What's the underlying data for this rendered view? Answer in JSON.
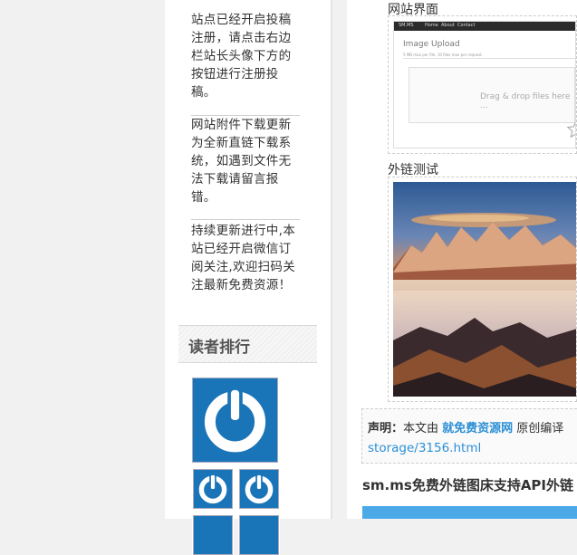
{
  "sidebar": {
    "notices": [
      "站点已经开启投稿注册，请点击右边栏站长头像下方的按钮进行注册投稿。",
      "网站附件下载更新为全新直链下载系统，如遇到文件无法下载请留言报错。",
      "持续更新进行中,本站已经开启微信订阅关注,欢迎扫码关注最新免费资源！"
    ],
    "readers_title": "读者排行",
    "avatar_color": "#1a74b8"
  },
  "content": {
    "caption_site": "网站界面",
    "caption_link": "外链测试",
    "screenshot": {
      "nav_logo": "SM.MS",
      "nav_items": [
        "Home",
        "About",
        "Contact"
      ],
      "title": "Image Upload",
      "subtitle": "5 MB max per file. 10 files max per request.",
      "dropzone_text": "Drag & drop files here ..."
    },
    "declaration": {
      "label": "声明：",
      "text_before": "本文由 ",
      "site_name": "就免费资源网",
      "text_after": " 原创编译",
      "url_tail": "storage/3156.html"
    },
    "post_heading": "sm.ms免费外链图床支持API外链",
    "link_color": "#2b8fd6"
  }
}
